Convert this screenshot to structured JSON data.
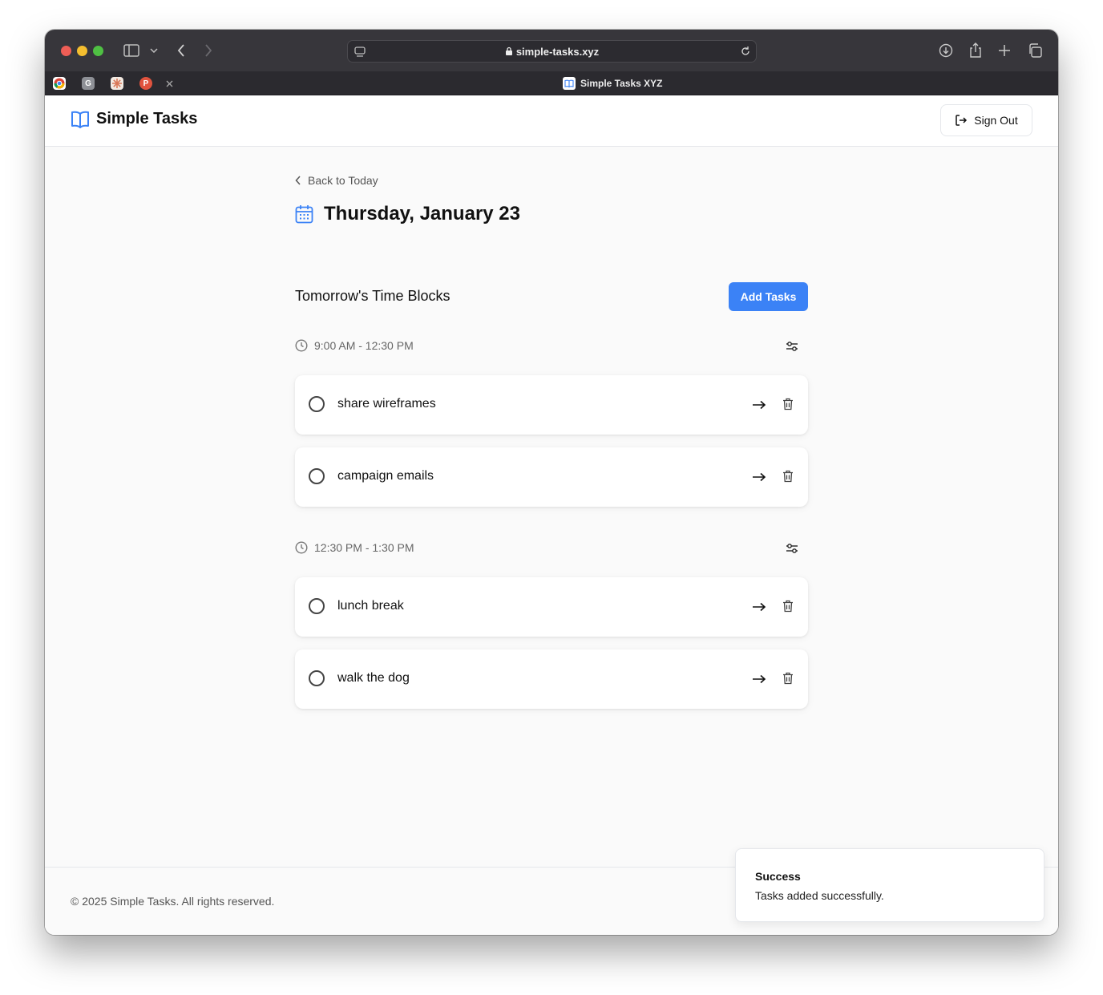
{
  "browser": {
    "url": "simple-tasks.xyz",
    "active_tab_title": "Simple Tasks XYZ",
    "pinned_tabs": [
      {
        "name": "chrome-tab",
        "letter": ""
      },
      {
        "name": "g-tab",
        "letter": "G"
      },
      {
        "name": "claude-tab",
        "letter": ""
      },
      {
        "name": "p-tab",
        "letter": "P"
      }
    ]
  },
  "header": {
    "brand": "Simple Tasks",
    "sign_out": "Sign Out"
  },
  "page": {
    "back_link": "Back to Today",
    "date_title": "Thursday, January 23",
    "section_title": "Tomorrow's Time Blocks",
    "add_tasks": "Add Tasks"
  },
  "blocks": [
    {
      "time": "9:00 AM - 12:30 PM",
      "tasks": [
        "share wireframes",
        "campaign emails"
      ]
    },
    {
      "time": "12:30 PM - 1:30 PM",
      "tasks": [
        "lunch break",
        "walk the dog"
      ]
    }
  ],
  "footer": {
    "copyright": "© 2025 Simple Tasks. All rights reserved."
  },
  "toast": {
    "title": "Success",
    "message": "Tasks added successfully."
  },
  "colors": {
    "accent": "#3b82f6",
    "titlebar": "#37363b"
  }
}
